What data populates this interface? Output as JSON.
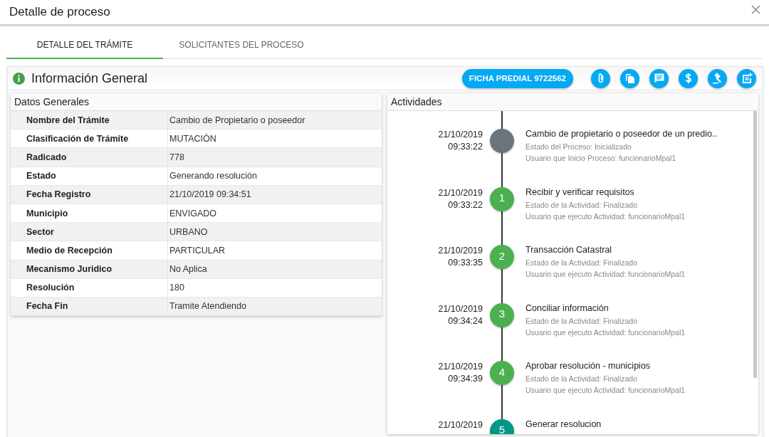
{
  "window": {
    "title": "Detalle de proceso"
  },
  "tabs": [
    {
      "label": "DETALLE DEL TRÁMITE",
      "selected": true
    },
    {
      "label": "SOLICITANTES DEL PROCESO",
      "selected": false
    }
  ],
  "panel": {
    "title": "Información General",
    "ficha_button": "FICHA PREDIAL 9722562",
    "actions": [
      {
        "kind": "attach"
      },
      {
        "kind": "copy"
      },
      {
        "kind": "comment"
      },
      {
        "kind": "dollar"
      },
      {
        "kind": "gavel"
      },
      {
        "kind": "note-add"
      }
    ]
  },
  "datos_generales": {
    "title": "Datos Generales",
    "rows": [
      {
        "label": "Nombre del Trámite",
        "value": "Cambio de Propietario o poseedor"
      },
      {
        "label": "Clasificación de Trámite",
        "value": "MUTACIÓN"
      },
      {
        "label": "Radicado",
        "value": "778"
      },
      {
        "label": "Estado",
        "value": "Generando resolución"
      },
      {
        "label": "Fecha Registro",
        "value": "21/10/2019 09:34:51"
      },
      {
        "label": "Municipio",
        "value": "ENVIGADO"
      },
      {
        "label": "Sector",
        "value": "URBANO"
      },
      {
        "label": "Medio de Recepción",
        "value": "PARTICULAR"
      },
      {
        "label": "Mecanismo Juridico",
        "value": "No Aplica"
      },
      {
        "label": "Resolución",
        "value": "180"
      },
      {
        "label": "Fecha Fin",
        "value": "Tramite Atendiendo"
      }
    ]
  },
  "actividades": {
    "title": "Actividades",
    "items": [
      {
        "date": "21/10/2019",
        "time": "09:33:22",
        "color": "#6c757d",
        "title": "Cambio de propietario o poseedor de un predio..",
        "lines": [
          "Estado del Proceso: Inicializado",
          "Usuario que Inicio Proceso: funcionarioMpal1"
        ]
      },
      {
        "date": "21/10/2019",
        "time": "09:33:22",
        "number": "1",
        "color": "#4caf50",
        "title": "Recibir y verificar requisitos",
        "lines": [
          "Estado de la Actividad: Finalizado",
          "Usuario que ejecuto Actividad: funcionarioMpal1"
        ]
      },
      {
        "date": "21/10/2019",
        "time": "09:33:35",
        "number": "2",
        "color": "#4caf50",
        "title": "Transacción Catastral",
        "lines": [
          "Estado de la Actividad: Finalizado",
          "Usuario que ejecuto Actividad: funcionarioMpal1"
        ]
      },
      {
        "date": "21/10/2019",
        "time": "09:34:24",
        "number": "3",
        "color": "#4caf50",
        "title": "Conciliar información",
        "lines": [
          "Estado de la Actividad: Finalizado",
          "Usuario que ejecuto Actividad: funcionarioMpal1"
        ]
      },
      {
        "date": "21/10/2019",
        "time": "09:34:39",
        "number": "4",
        "color": "#4caf50",
        "title": "Aprobar resolución - municipios",
        "lines": [
          "Estado de la Actividad: Finalizado",
          "Usuario que ejecuto Actividad: funcionarioMpal1"
        ]
      },
      {
        "date": "21/10/2019",
        "number": "5",
        "color": "#009688",
        "title": "Generar resolucion"
      }
    ]
  }
}
